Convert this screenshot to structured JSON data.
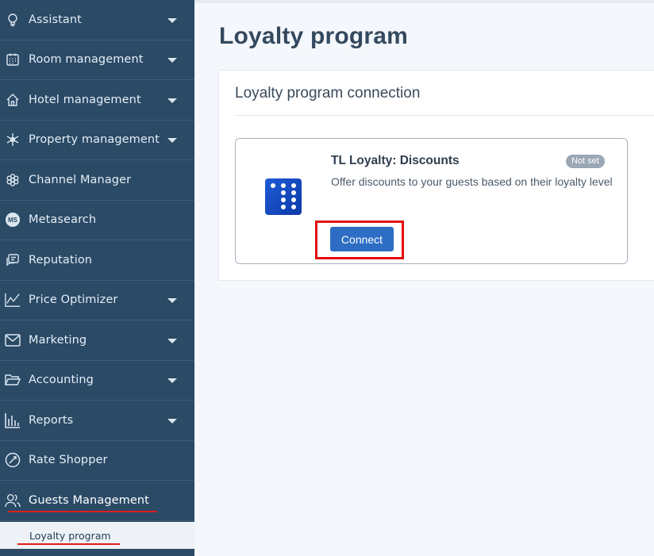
{
  "sidebar": {
    "items": [
      {
        "label": "Assistant",
        "icon": "lightbulb-icon",
        "has_caret": true
      },
      {
        "label": "Room management",
        "icon": "calendar-grid-icon",
        "has_caret": true
      },
      {
        "label": "Hotel management",
        "icon": "house-icon",
        "has_caret": true
      },
      {
        "label": "Property management",
        "icon": "snowflake-icon",
        "has_caret": true
      },
      {
        "label": "Channel Manager",
        "icon": "flower-icon",
        "has_caret": false
      },
      {
        "label": "Metasearch",
        "icon": "ms-badge-icon",
        "icon_text": "MS",
        "has_caret": false
      },
      {
        "label": "Reputation",
        "icon": "chat-bubble-icon",
        "has_caret": false
      },
      {
        "label": "Price Optimizer",
        "icon": "line-chart-icon",
        "has_caret": true
      },
      {
        "label": "Marketing",
        "icon": "envelope-icon",
        "has_caret": true
      },
      {
        "label": "Accounting",
        "icon": "folder-open-icon",
        "has_caret": true
      },
      {
        "label": "Reports",
        "icon": "bar-chart-icon",
        "has_caret": true
      },
      {
        "label": "Rate Shopper",
        "icon": "gauge-icon",
        "has_caret": false
      },
      {
        "label": "Guests Management",
        "icon": "users-icon",
        "has_caret": false,
        "active": true
      }
    ],
    "subitem": {
      "label": "Loyalty program"
    }
  },
  "main": {
    "title": "Loyalty program",
    "section_title": "Loyalty program connection",
    "card": {
      "title": "TL Loyalty: Discounts",
      "badge": "Not set",
      "description": "Offer discounts to your guests based on their loyalty level",
      "button": "Connect"
    }
  },
  "colors": {
    "sidebar_bg": "#2a4a66",
    "primary_button": "#2d6ec4",
    "annotation_red": "#e10f0f",
    "badge_bg": "#9aa7b4"
  }
}
